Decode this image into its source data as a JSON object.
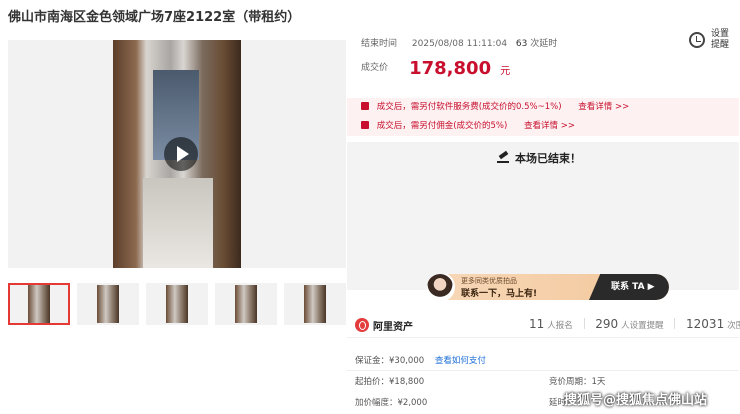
{
  "title": "佛山市南海区金色领域广场7座2122室（带租约）",
  "auction": {
    "end_label": "结束时间",
    "end_time": "2025/08/08 11:11:04",
    "delay_count": "63",
    "delay_suffix": "次延时",
    "remind_label": "设置提醒",
    "price_label": "成交价",
    "price": "178,800",
    "price_unit": "元",
    "notices": [
      {
        "text": "成交后，需另付软件服务费(成交价的0.5%~1%)",
        "link": "查看详情 >>"
      },
      {
        "text": "成交后，需另付佣金(成交价的5%)",
        "link": "查看详情 >>"
      }
    ],
    "ended_text": "本场已结束！"
  },
  "banner": {
    "small": "更多同类优质拍品",
    "big": "联系一下，马上有!",
    "cta": "联系 TA ▶"
  },
  "brand": {
    "name": "阿里资产",
    "stats": [
      {
        "n": "11",
        "label": "人报名"
      },
      {
        "n": "290",
        "label": "人设置提醒"
      },
      {
        "n": "12031",
        "label": "次围观"
      }
    ]
  },
  "details": {
    "deposit": "保证金：¥30,000",
    "deposit_link": "查看如何支付",
    "start_price": "起拍价：¥18,800",
    "cycle": "竞价周期：1天",
    "increment": "加价幅度：¥2,000",
    "delay_label": "延时"
  },
  "watermark": "搜狐号@搜狐焦点佛山站",
  "colors": {
    "accent": "#c8102e",
    "link": "#1e6fd9"
  }
}
